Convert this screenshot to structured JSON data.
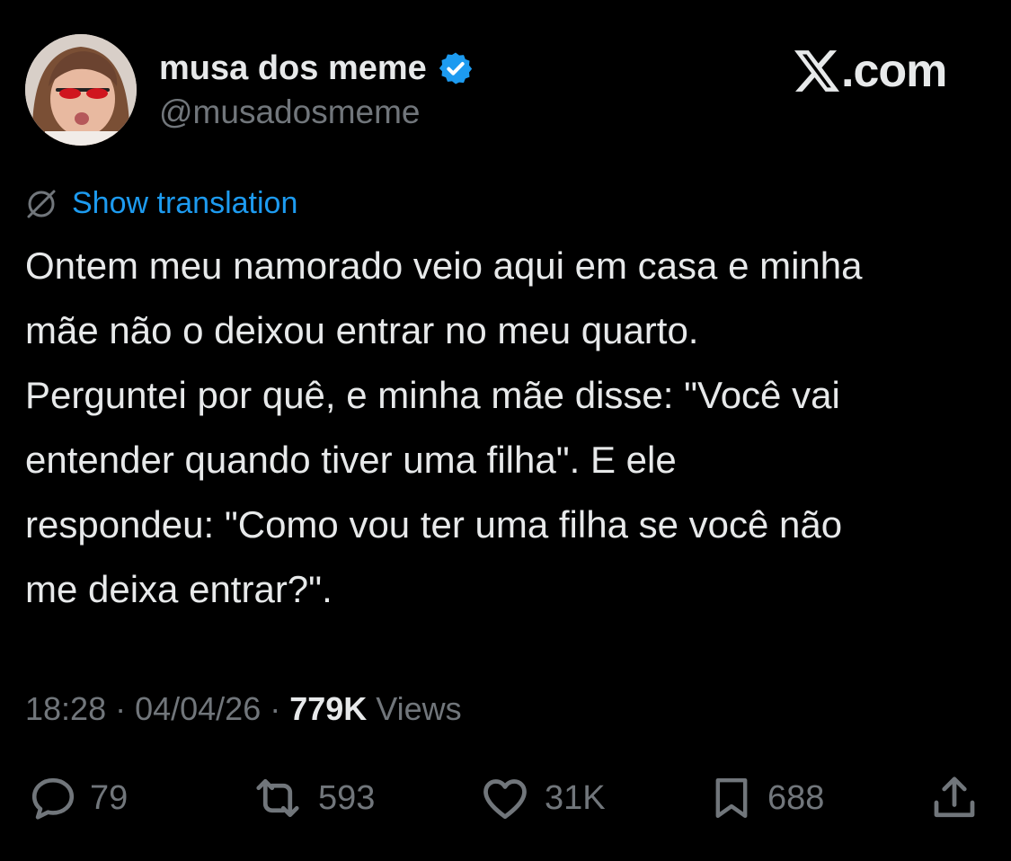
{
  "author": {
    "display_name": "musa dos meme",
    "handle": "@musadosmeme",
    "verified_icon": "verified-badge-icon"
  },
  "brand": {
    "text": ".com",
    "logo_icon": "x-logo-icon"
  },
  "translation": {
    "icon": "globe-icon",
    "label": "Show translation"
  },
  "tweet": {
    "lines": [
      "Ontem meu namorado veio aqui em casa e minha",
      "mãe não o deixou entrar no meu quarto.",
      "Perguntei por quê, e minha mãe disse: \"Você vai",
      "entender quando tiver uma filha\". E ele",
      "respondeu: \"Como vou ter uma filha se você não",
      "me deixa entrar?\"."
    ]
  },
  "meta": {
    "time": "18:28",
    "separator": "·",
    "date": "04/04/26",
    "views_count": "779K",
    "views_label": "Views"
  },
  "actions": {
    "replies": "79",
    "reposts": "593",
    "likes": "31K",
    "bookmarks": "688"
  },
  "colors": {
    "background": "#000000",
    "primary_text": "#e7e9ea",
    "secondary_text": "#71767b",
    "link": "#1d9bf0",
    "verified": "#1d9bf0"
  }
}
